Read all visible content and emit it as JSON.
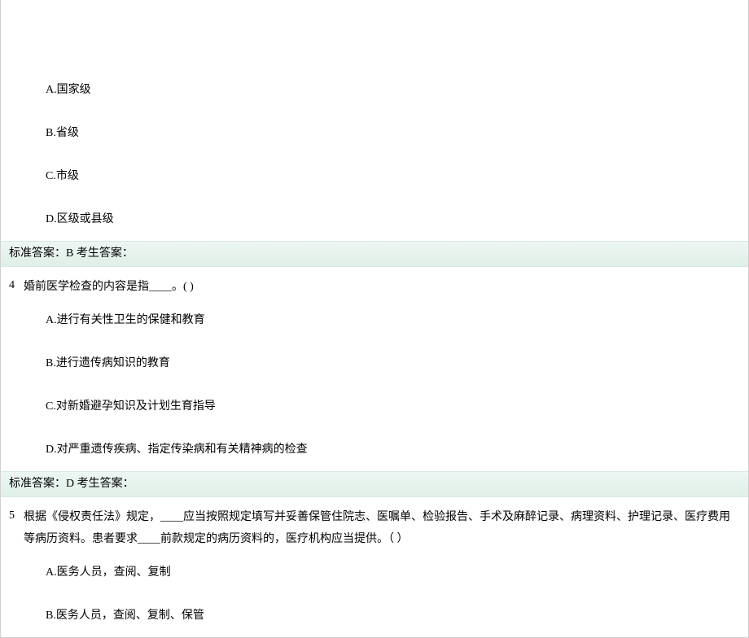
{
  "questions": [
    {
      "num": "",
      "text": "",
      "options": [
        "A.国家级",
        "B.省级",
        "C.市级",
        "D.区级或县级"
      ],
      "answer": "标准答案：B 考生答案："
    },
    {
      "num": "4",
      "text": "婚前医学检查的内容是指____。( )",
      "options": [
        "A.进行有关性卫生的保健和教育",
        "B.进行遗传病知识的教育",
        "C.对新婚避孕知识及计划生育指导",
        "D.对严重遗传疾病、指定传染病和有关精神病的检查"
      ],
      "answer": "标准答案：D 考生答案："
    },
    {
      "num": "5",
      "text": "根据《侵权责任法》规定，____应当按照规定填写并妥善保管住院志、医嘱单、检验报告、手术及麻醉记录、病理资料、护理记录、医疗费用等病历资料。患者要求____前款规定的病历资料的，医疗机构应当提供。（  ）",
      "options": [
        "A.医务人员，查阅、复制",
        "B.医务人员，查阅、复制、保管"
      ],
      "answer": ""
    }
  ]
}
